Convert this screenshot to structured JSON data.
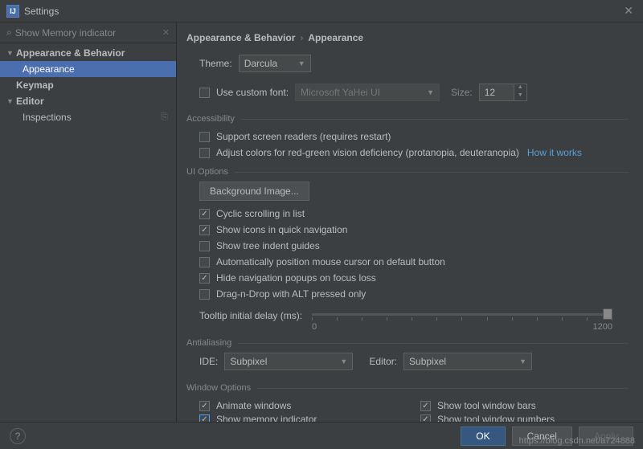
{
  "title": "Settings",
  "search": {
    "text": "Show Memory indicator"
  },
  "tree": {
    "appearance_behavior": "Appearance & Behavior",
    "appearance": "Appearance",
    "keymap": "Keymap",
    "editor": "Editor",
    "inspections": "Inspections"
  },
  "breadcrumb": {
    "a": "Appearance & Behavior",
    "b": "Appearance"
  },
  "theme": {
    "label": "Theme:",
    "value": "Darcula"
  },
  "custom_font": {
    "label": "Use custom font:",
    "value": "Microsoft YaHei UI",
    "size_label": "Size:",
    "size_value": "12"
  },
  "sections": {
    "accessibility": "Accessibility",
    "ui_options": "UI Options",
    "antialiasing": "Antialiasing",
    "window_options": "Window Options"
  },
  "accessibility": {
    "screen_readers": "Support screen readers (requires restart)",
    "color_deficiency": "Adjust colors for red-green vision deficiency (protanopia, deuteranopia)",
    "how_it_works": "How it works"
  },
  "ui": {
    "bg_image_btn": "Background Image...",
    "cyclic": "Cyclic scrolling in list",
    "icons_quick_nav": "Show icons in quick navigation",
    "tree_indent": "Show tree indent guides",
    "auto_cursor": "Automatically position mouse cursor on default button",
    "hide_popups": "Hide navigation popups on focus loss",
    "dnd_alt": "Drag-n-Drop with ALT pressed only",
    "tooltip_delay": "Tooltip initial delay (ms):",
    "slider_min": "0",
    "slider_max": "1200"
  },
  "aa": {
    "ide_label": "IDE:",
    "ide_value": "Subpixel",
    "editor_label": "Editor:",
    "editor_value": "Subpixel"
  },
  "win": {
    "animate": "Animate windows",
    "memory": "Show memory indicator",
    "tool_bars": "Show tool window bars",
    "tool_numbers": "Show tool window numbers"
  },
  "footer": {
    "ok": "OK",
    "cancel": "Cancel",
    "apply": "Apply"
  },
  "watermark": "https://blog.csdn.net/a724888"
}
